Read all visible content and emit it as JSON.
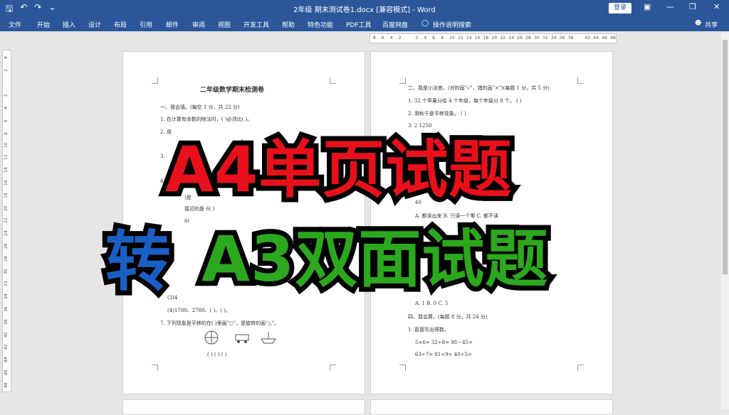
{
  "window": {
    "title": "2年级  期末测试卷1.docx [兼容模式] - Word",
    "login_label": "登录",
    "share_label": "共享"
  },
  "menu": {
    "items": [
      "文件",
      "开始",
      "插入",
      "设计",
      "布局",
      "引用",
      "邮件",
      "审阅",
      "视图",
      "开发工具",
      "帮助",
      "特色功能",
      "PDF工具",
      "百度网盘",
      "操作说明搜索"
    ]
  },
  "ruler": {
    "h_ticks": [
      "8",
      "6",
      "4",
      "2",
      "",
      "2",
      "4",
      "6",
      "8",
      "10",
      "12",
      "14",
      "16",
      "18",
      "20",
      "22",
      "24",
      "26",
      "28",
      "30",
      "32",
      "34",
      "36",
      "38",
      "",
      "42",
      "44",
      "46",
      "48"
    ],
    "v_ticks": [
      "4",
      "2",
      "",
      "2",
      "4",
      "6",
      "8",
      "10",
      "12",
      "14",
      "16",
      "18",
      "20",
      "22",
      "24",
      "26",
      "28",
      "30",
      "32",
      "34",
      "36",
      "38",
      "40",
      "42",
      "44",
      "46",
      "48"
    ]
  },
  "page_left": {
    "title": "二年级数学期末检测卷",
    "lines": [
      "一、我会填。(每空 1 分，共 22 分)",
      "1. 在计算有余数的除法时，(      )必须比(      )。",
      "2. 用",
      "3.",
      "4.",
      ")是",
      "接近的是 6(      )",
      "6(",
      "(3)4",
      "(4)1780、2780、(      )、(      )。",
      "7. 下列现象是平移的在(      )里画\"○\"，是旋转的画\"△\"。",
      "(      )          (      )          (      )"
    ]
  },
  "page_right": {
    "lines": [
      "二、我是小法官。(对的画\"√\"，错的画\"×\")(每题 1 分，共 5 分)",
      "1. 32 个苹果分给 4 个年级，每个年级分 8 个。          (      )",
      "2. 滑秋千是平移现象。                                  (      )",
      "3. 2 1250",
      "40",
      "A. 都读出来      B. 只读一个零      C. 都不读",
      "A. 1             B. 0              C. 5",
      "四、我会算。(每题 8 分，共 24 分)",
      "1. 直接写出得数。",
      "5×6=            32÷8=            98－45=",
      "63÷7=           81÷9=            40÷5="
    ]
  },
  "overlay": {
    "line1": "A4单页试题",
    "line2_a": "转",
    "line2_b": "A3双面试题"
  },
  "colors": {
    "title_bar": "#2b579a",
    "overlay_red": "#e8101a",
    "overlay_blue": "#1a5fc4",
    "overlay_green": "#2ca81e"
  }
}
